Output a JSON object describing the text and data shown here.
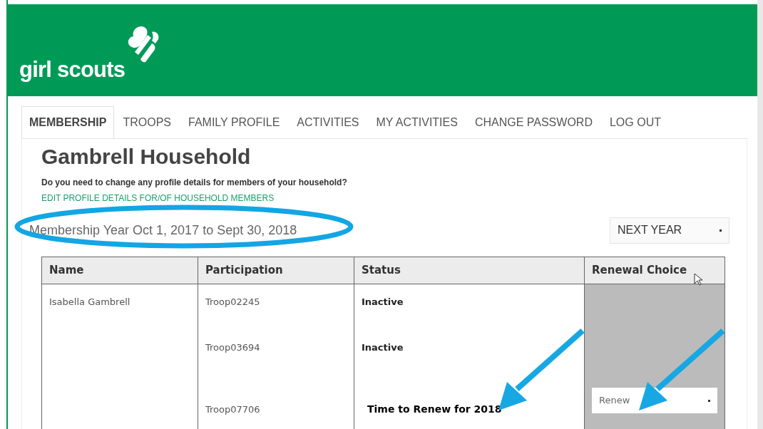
{
  "header": {
    "logo_text": "girl scouts"
  },
  "tabs": [
    {
      "label": "MEMBERSHIP",
      "selected": true
    },
    {
      "label": "TROOPS",
      "selected": false
    },
    {
      "label": "FAMILY PROFILE",
      "selected": false
    },
    {
      "label": "ACTIVITIES",
      "selected": false
    },
    {
      "label": "MY ACTIVITIES",
      "selected": false
    },
    {
      "label": "CHANGE PASSWORD",
      "selected": false
    },
    {
      "label": "LOG OUT",
      "selected": false
    }
  ],
  "title": "Gambrell Household",
  "question": "Do you need to change any profile details for members of your household?",
  "edit_link": "EDIT PROFILE DETAILS FOR/OF HOUSEHOLD MEMBERS",
  "membership_year": "Membership Year Oct 1, 2017 to Sept 30, 2018",
  "year_select": {
    "value": "NEXT YEAR"
  },
  "table": {
    "columns": [
      "Name",
      "Participation",
      "Status",
      "Renewal Choice"
    ],
    "members": [
      {
        "name": "Isabella Gambrell",
        "participations": [
          {
            "troop": "Troop02245",
            "status": "Inactive",
            "kind": "inactive"
          },
          {
            "troop": "Troop03694",
            "status": "Inactive",
            "kind": "inactive"
          },
          {
            "troop": "Troop07706",
            "status": "Time to Renew for 2018",
            "kind": "renew",
            "renewal": "Renew"
          }
        ]
      }
    ]
  }
}
